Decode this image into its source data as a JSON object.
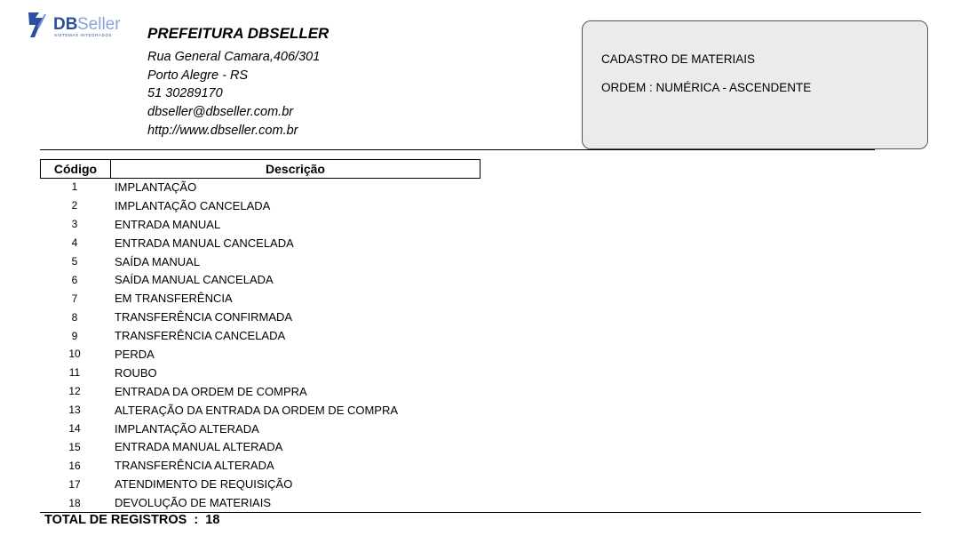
{
  "logo": {
    "brand_bold": "DB",
    "brand_light": "Seller",
    "tagline": "SISTEMAS INTEGRADOS"
  },
  "header": {
    "org_name": "PREFEITURA DBSELLER",
    "address": "Rua General Camara,406/301",
    "city": "Porto Alegre - RS",
    "phone": "51 30289170",
    "email": "dbseller@dbseller.com.br",
    "website": "http://www.dbseller.com.br"
  },
  "report": {
    "title": "CADASTRO DE MATERIAIS",
    "order": "ORDEM : NUMÉRICA - ASCENDENTE"
  },
  "table": {
    "columns": [
      "Código",
      "Descrição"
    ],
    "rows": [
      {
        "code": "1",
        "desc": "IMPLANTAÇÃO"
      },
      {
        "code": "2",
        "desc": "IMPLANTAÇÃO CANCELADA"
      },
      {
        "code": "3",
        "desc": "ENTRADA MANUAL"
      },
      {
        "code": "4",
        "desc": "ENTRADA MANUAL CANCELADA"
      },
      {
        "code": "5",
        "desc": "SAÍDA MANUAL"
      },
      {
        "code": "6",
        "desc": "SAÍDA MANUAL CANCELADA"
      },
      {
        "code": "7",
        "desc": "EM TRANSFERÊNCIA"
      },
      {
        "code": "8",
        "desc": "TRANSFERÊNCIA CONFIRMADA"
      },
      {
        "code": "9",
        "desc": "TRANSFERÊNCIA CANCELADA"
      },
      {
        "code": "10",
        "desc": "PERDA"
      },
      {
        "code": "11",
        "desc": "ROUBO"
      },
      {
        "code": "12",
        "desc": "ENTRADA DA ORDEM DE COMPRA"
      },
      {
        "code": "13",
        "desc": "ALTERAÇÃO DA ENTRADA DA ORDEM DE COMPRA"
      },
      {
        "code": "14",
        "desc": "IMPLANTAÇÃO ALTERADA"
      },
      {
        "code": "15",
        "desc": "ENTRADA MANUAL ALTERADA"
      },
      {
        "code": "16",
        "desc": "TRANSFERÊNCIA ALTERADA"
      },
      {
        "code": "17",
        "desc": "ATENDIMENTO DE REQUISIÇÃO"
      },
      {
        "code": "18",
        "desc": "DEVOLUÇÃO DE MATERIAIS"
      }
    ]
  },
  "footer": {
    "total_label": "TOTAL DE REGISTROS  :",
    "total_value": "18"
  },
  "colors": {
    "logo_blue": "#2b4f9e",
    "box_bg": "#ebebeb"
  },
  "icons": {
    "logo": "dbseller-logo-icon"
  }
}
